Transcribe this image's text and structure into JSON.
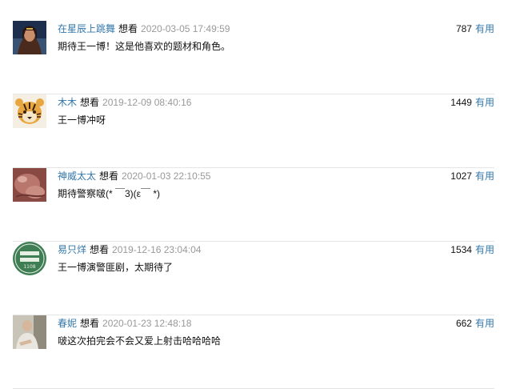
{
  "comments": [
    {
      "user": "在星辰上跳舞",
      "status": "想看",
      "time": "2020-03-05 17:49:59",
      "text": "期待王一博！这是他喜欢的题材和角色。",
      "count": "787",
      "useful": "有用",
      "avatar_icon": "woman-portrait-avatar"
    },
    {
      "user": "木木",
      "status": "想看",
      "time": "2019-12-09 08:40:16",
      "text": "王一博冲呀",
      "count": "1449",
      "useful": "有用",
      "avatar_icon": "tiger-avatar"
    },
    {
      "user": "神威太太",
      "status": "想看",
      "time": "2020-01-03 22:10:55",
      "text": "期待警察啵(* ￣3)(ε￣ *)",
      "count": "1027",
      "useful": "有用",
      "avatar_icon": "hand-closeup-avatar"
    },
    {
      "user": "易只烊",
      "status": "想看",
      "time": "2019-12-16 23:04:04",
      "text": "王一博演警匪剧，太期待了",
      "count": "1534",
      "useful": "有用",
      "avatar_icon": "green-badge-avatar",
      "avatar_badge_text": "1108"
    },
    {
      "user": "春妮",
      "status": "想看",
      "time": "2020-01-23 12:48:18",
      "text": "啵这次拍完会不会又爱上射击哈哈哈哈",
      "count": "662",
      "useful": "有用",
      "avatar_icon": "person-photo-avatar"
    }
  ]
}
